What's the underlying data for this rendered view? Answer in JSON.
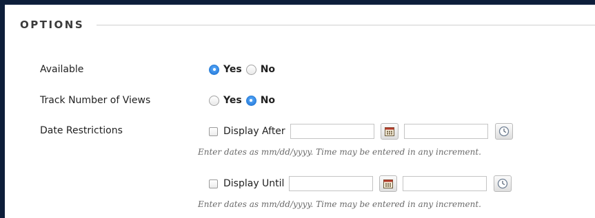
{
  "section": {
    "title": "OPTIONS"
  },
  "available": {
    "label": "Available",
    "options": [
      {
        "label": "Yes",
        "checked": true
      },
      {
        "label": "No",
        "checked": false
      }
    ]
  },
  "track_views": {
    "label": "Track Number of Views",
    "options": [
      {
        "label": "Yes",
        "checked": false
      },
      {
        "label": "No",
        "checked": true
      }
    ]
  },
  "date_restrictions": {
    "label": "Date Restrictions",
    "display_after": {
      "label": "Display After",
      "checked": false,
      "date_value": "",
      "time_value": "",
      "hint": "Enter dates as mm/dd/yyyy. Time may be entered in any increment."
    },
    "display_until": {
      "label": "Display Until",
      "checked": false,
      "date_value": "",
      "time_value": "",
      "hint": "Enter dates as mm/dd/yyyy. Time may be entered in any increment."
    }
  },
  "icons": {
    "calendar": "calendar-icon",
    "clock": "clock-icon"
  },
  "colors": {
    "page_background": "#0d1e3a",
    "radio_selected": "#1c6fd1"
  }
}
